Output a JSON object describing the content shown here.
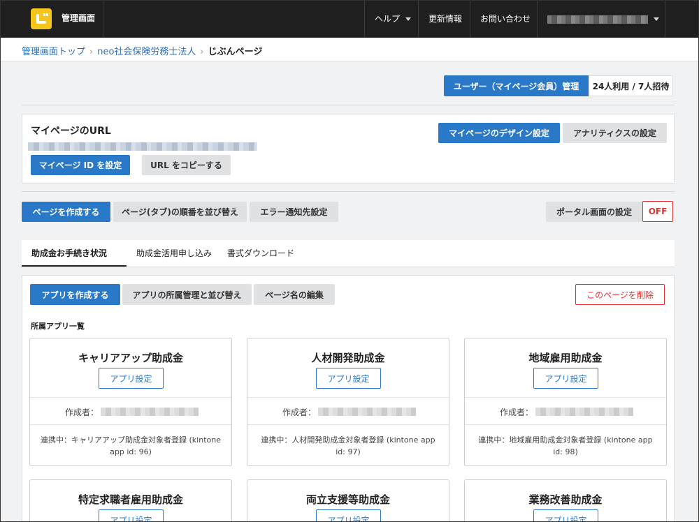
{
  "header": {
    "app_title": "管理画面",
    "nav": {
      "help": "ヘルプ",
      "updates": "更新情報",
      "contact": "お問い合わせ"
    }
  },
  "breadcrumb": {
    "home": "管理画面トップ",
    "org": "neo社会保険労務士法人",
    "current": "じぶんページ",
    "sep": "›"
  },
  "members": {
    "button": "ユーザー（マイページ会員）管理",
    "count": "24人利用 / 7人招待"
  },
  "mypage": {
    "title": "マイページのURL",
    "set_id_button": "マイページ ID を設定",
    "copy_url_button": "URL をコピーする",
    "design_button": "マイページのデザイン設定",
    "analytics_button": "アナリティクスの設定"
  },
  "toolbar": {
    "create_page": "ページを作成する",
    "reorder_pages": "ページ(タブ)の順番を並び替え",
    "error_notify": "エラー通知先設定",
    "portal_setting": "ポータル画面の設定",
    "portal_state": "OFF"
  },
  "tabs": [
    {
      "label": "助成金お手続き状況",
      "active": true
    },
    {
      "label": "助成金活用申し込み",
      "active": false
    },
    {
      "label": "書式ダウンロード",
      "active": false
    }
  ],
  "page_panel": {
    "create_app": "アプリを作成する",
    "manage_apps": "アプリの所属管理と並び替え",
    "rename_page": "ページ名の編集",
    "delete_page": "このページを削除",
    "apps_heading": "所属アプリ一覧"
  },
  "apps": [
    {
      "title": "キャリアアップ助成金",
      "settings": "アプリ設定",
      "author_label": "作成者：",
      "linked": "連携中：キャリアアップ助成金対象者登録 (kintone app id: 96)"
    },
    {
      "title": "人材開発助成金",
      "settings": "アプリ設定",
      "author_label": "作成者：",
      "linked": "連携中：人材開発助成金対象者登録 (kintone app id: 97)"
    },
    {
      "title": "地域雇用助成金",
      "settings": "アプリ設定",
      "author_label": "作成者：",
      "linked": "連携中：地域雇用助成金対象者登録 (kintone app id: 98)"
    },
    {
      "title": "特定求職者雇用助成金",
      "settings": "アプリ設定"
    },
    {
      "title": "両立支援等助成金",
      "settings": "アプリ設定"
    },
    {
      "title": "業務改善助成金",
      "settings": "アプリ設定"
    }
  ],
  "colors": {
    "accent": "#2a78c8",
    "header_bg": "#1f1f1f",
    "logo": "#f4c51c",
    "danger": "#d33"
  }
}
